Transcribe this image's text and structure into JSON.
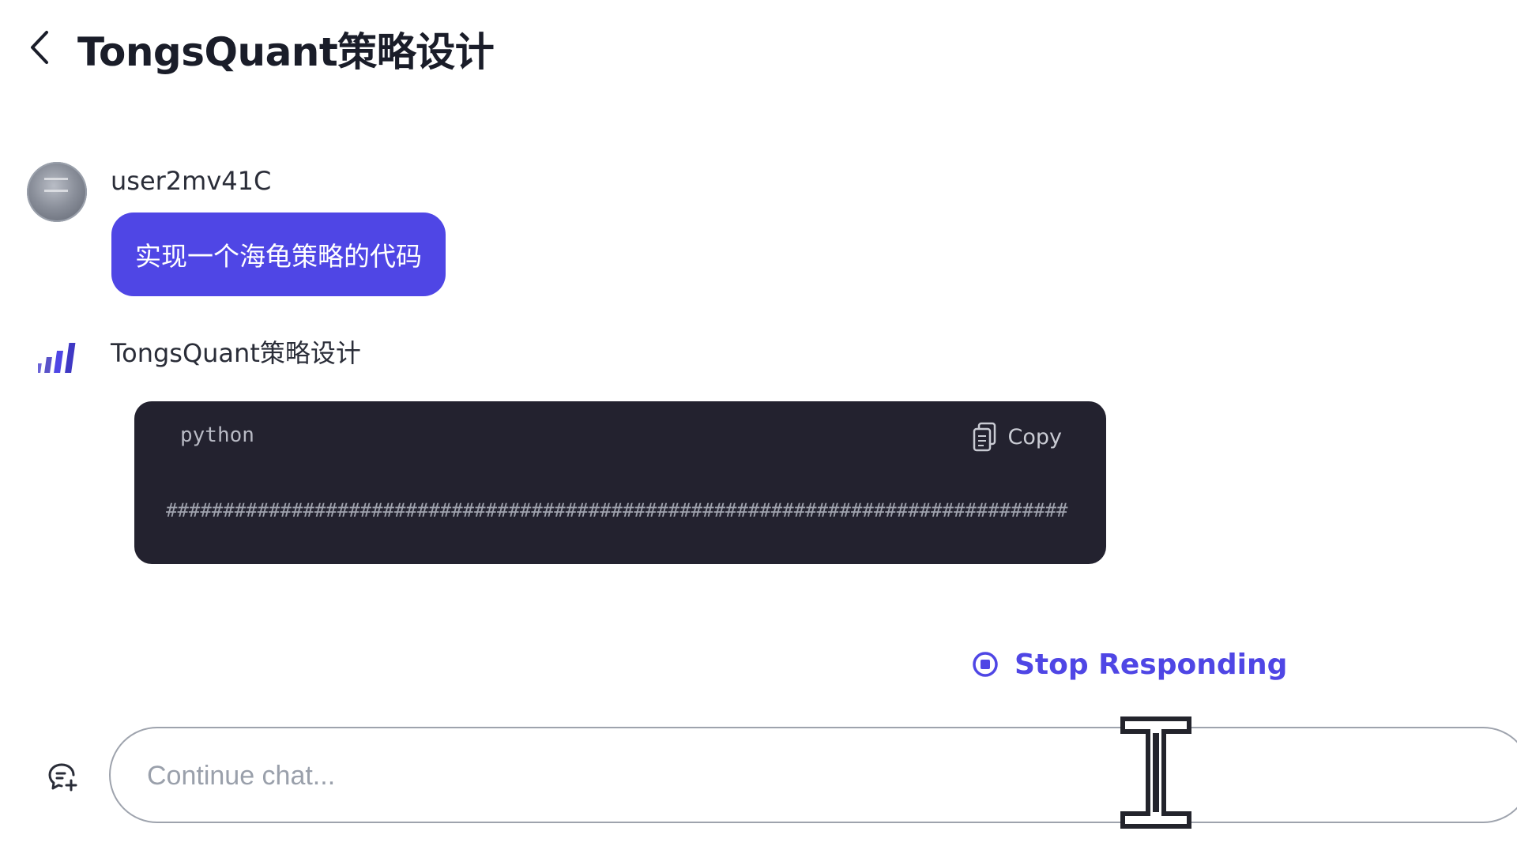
{
  "header": {
    "back_icon": "chevron-left-icon",
    "title": "TongsQuant策略设计"
  },
  "conversation": {
    "user_message": {
      "username": "user2mv41C",
      "text": "实现一个海龟策略的代码"
    },
    "bot_message": {
      "name": "TongsQuant策略设计",
      "logo_icon": "bar-chart-logo-icon",
      "code_block": {
        "language": "python",
        "copy_label": "Copy",
        "copy_icon": "clipboard-copy-icon",
        "code": "###############################################################################"
      }
    }
  },
  "actions": {
    "stop_label": "Stop Responding",
    "stop_icon": "stop-circle-icon"
  },
  "input": {
    "placeholder": "Continue chat...",
    "value": "",
    "new_chat_icon": "new-chat-icon"
  },
  "colors": {
    "accent": "#4f46e5",
    "code_background": "#23222f"
  }
}
